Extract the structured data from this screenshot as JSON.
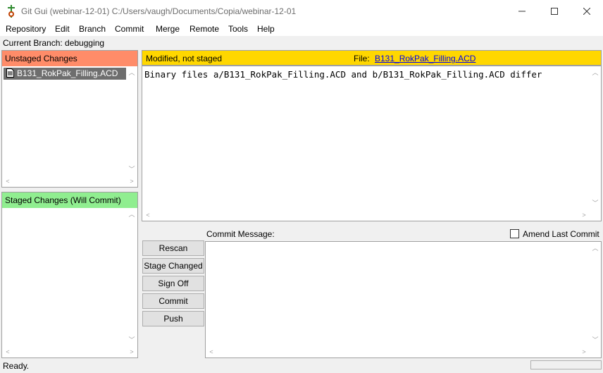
{
  "window": {
    "title": "Git Gui (webinar-12-01) C:/Users/vaugh/Documents/Copia/webinar-12-01"
  },
  "menu": [
    "Repository",
    "Edit",
    "Branch",
    "Commit",
    "Merge",
    "Remote",
    "Tools",
    "Help"
  ],
  "branch": {
    "label": "Current Branch: debugging"
  },
  "unstaged": {
    "title": "Unstaged Changes",
    "color": "#ff8c69",
    "files": [
      "B131_RokPak_Filling.ACD"
    ]
  },
  "staged": {
    "title": "Staged Changes (Will Commit)",
    "color": "#90ee90"
  },
  "diff": {
    "status": "Modified, not staged",
    "file_label": "File:",
    "file_name": "B131_RokPak_Filling.ACD",
    "header_color": "#ffd700",
    "content": "Binary files a/B131_RokPak_Filling.ACD and b/B131_RokPak_Filling.ACD differ"
  },
  "buttons": {
    "rescan": "Rescan",
    "stage_changed": "Stage Changed",
    "sign_off": "Sign Off",
    "commit": "Commit",
    "push": "Push"
  },
  "commit": {
    "label": "Commit Message:",
    "amend_label": "Amend Last Commit",
    "amend_checked": false
  },
  "status": {
    "text": "Ready."
  }
}
